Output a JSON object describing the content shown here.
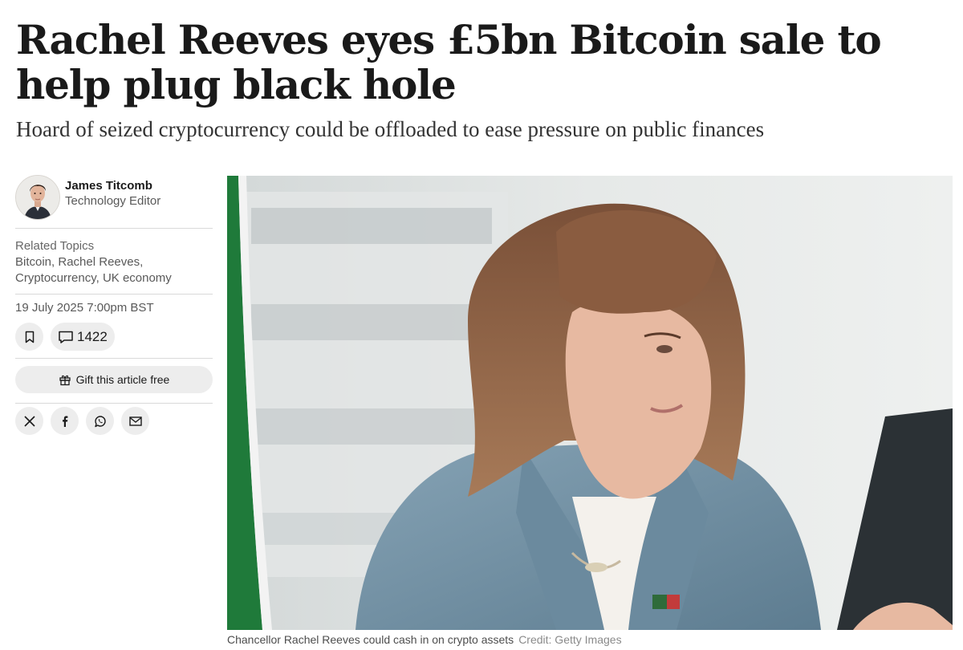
{
  "article": {
    "headline": "Rachel Reeves eyes £5bn Bitcoin sale to help plug black hole",
    "standfirst": "Hoard of seized cryptocurrency could be offloaded to ease pressure on public finances",
    "caption": "Chancellor Rachel Reeves could cash in on crypto assets",
    "credit": "Credit: Getty Images"
  },
  "author": {
    "name": "James Titcomb",
    "role": "Technology Editor",
    "avatar_icon": "author-avatar"
  },
  "topics": {
    "heading": "Related Topics",
    "items": [
      "Bitcoin,",
      "Rachel Reeves,",
      "Cryptocurrency,",
      "UK economy"
    ]
  },
  "meta": {
    "date": "19 July 2025 7:00pm BST"
  },
  "actions": {
    "bookmark_icon": "bookmark-icon",
    "comments_icon": "comment-icon",
    "comment_count": "1422",
    "gift_icon": "gift-icon",
    "gift_label": "Gift this article free"
  },
  "share": {
    "icons": [
      "x-icon",
      "facebook-icon",
      "whatsapp-icon",
      "email-icon"
    ]
  },
  "colors": {
    "text": "#1a1a1a",
    "muted": "#595959",
    "button_bg": "#ededed",
    "divider": "#d9d9d9",
    "flag_green": "#1f7a3a",
    "jacket_blue": "#7a98ab"
  }
}
